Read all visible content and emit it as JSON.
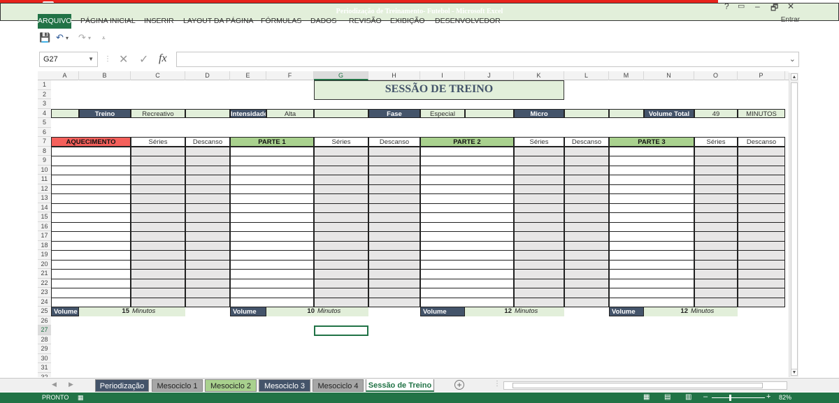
{
  "window": {
    "title": "Periodização de Treinamento- Futebol -  Microsoft Excel",
    "help": "?",
    "minimize": "–",
    "restore": "🗗",
    "close": "✕"
  },
  "ribbon": {
    "tabs": [
      "ARQUIVO",
      "PÁGINA INICIAL",
      "INSERIR",
      "LAYOUT DA PÁGINA",
      "FÓRMULAS",
      "DADOS",
      "REVISÃO",
      "EXIBIÇÃO",
      "DESENVOLVEDOR"
    ],
    "signin": "Entrar"
  },
  "formula_bar": {
    "name_box": "G27",
    "fx": "fx",
    "formula": ""
  },
  "columns": [
    "A",
    "B",
    "C",
    "D",
    "E",
    "F",
    "G",
    "H",
    "I",
    "J",
    "K",
    "L",
    "M",
    "N",
    "O",
    "P"
  ],
  "rows": [
    "1",
    "2",
    "3",
    "4",
    "5",
    "6",
    "7",
    "8",
    "9",
    "10",
    "11",
    "12",
    "13",
    "14",
    "15",
    "16",
    "17",
    "18",
    "19",
    "20",
    "21",
    "22",
    "23",
    "24",
    "25",
    "26",
    "27",
    "28",
    "29",
    "30",
    "31",
    "32"
  ],
  "selected_cell": "G27",
  "sheet": {
    "title": "SESSÃO DE TREINO",
    "info": {
      "treino_label": "Treino",
      "treino_value": "Recreativo",
      "intensidade_label": "Intensidade",
      "intensidade_value": "Alta",
      "fase_label": "Fase",
      "fase_value": "Especial",
      "micro_label": "Micro",
      "volume_total_label": "Volume Total",
      "volume_total_value": "49",
      "volume_total_unit": "MINUTOS"
    },
    "sections": [
      {
        "name": "AQUECIMENTO",
        "series": "Séries",
        "descanso": "Descanso",
        "volume_label": "Volume",
        "volume_value": "15",
        "volume_unit": "Minutos"
      },
      {
        "name": "PARTE 1",
        "series": "Séries",
        "descanso": "Descanso",
        "volume_label": "Volume",
        "volume_value": "10",
        "volume_unit": "Minutos"
      },
      {
        "name": "PARTE 2",
        "series": "Séries",
        "descanso": "Descanso",
        "volume_label": "Volume",
        "volume_value": "12",
        "volume_unit": "Minutos"
      },
      {
        "name": "PARTE 3",
        "series": "Séries",
        "descanso": "Descanso",
        "volume_label": "Volume",
        "volume_value": "12",
        "volume_unit": "Minutos"
      }
    ]
  },
  "sheet_tabs": [
    {
      "label": "Periodização",
      "color": "#44546a"
    },
    {
      "label": "Mesociclo 1",
      "color": "#a6a6a6"
    },
    {
      "label": "Mesociclo 2",
      "color": "#a9d18e"
    },
    {
      "label": "Mesociclo 3",
      "color": "#44546a"
    },
    {
      "label": "Mesociclo 4",
      "color": "#a6a6a6"
    },
    {
      "label": "Sessão de Treino",
      "color": "#ffffff",
      "active": true
    }
  ],
  "status": {
    "ready": "PRONTO",
    "zoom": "82%",
    "minus": "–",
    "plus": "+"
  },
  "colors": {
    "excel_green": "#217346",
    "title_red": "#e8231b",
    "header_dark": "#44546a",
    "light_green": "#e2efda",
    "part_green": "#a9d18e",
    "warmup_red": "#f4605b",
    "body_gray": "#e7e6e6"
  }
}
